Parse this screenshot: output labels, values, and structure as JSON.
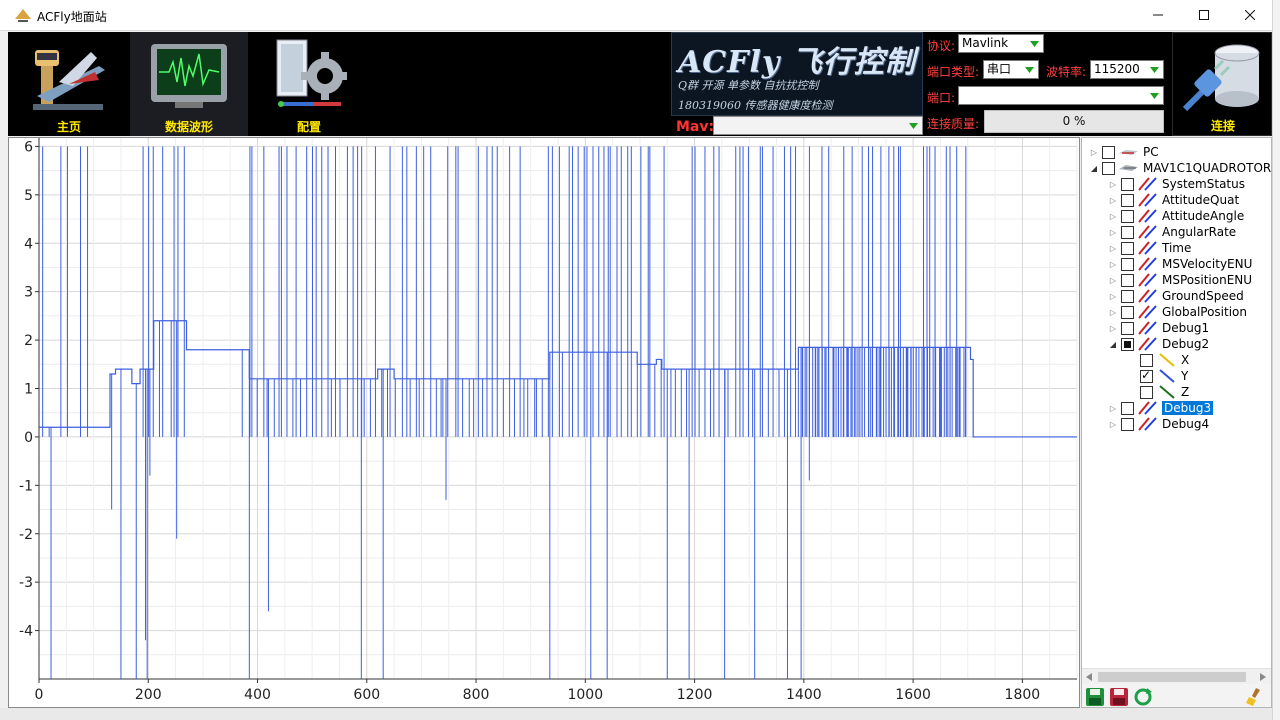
{
  "window": {
    "title": "ACFly地面站"
  },
  "nav": [
    {
      "label": "主页",
      "icon": "airport-tower-icon"
    },
    {
      "label": "数据波形",
      "icon": "oscilloscope-icon"
    },
    {
      "label": "配置",
      "icon": "gear-config-icon"
    }
  ],
  "logo": {
    "title": "ACFly 飞行控制",
    "line1": "Q群   开源 单参数 自抗扰控制",
    "line2": "180319060  传感器健康度检测"
  },
  "mav": {
    "label": "Mav:",
    "value": ""
  },
  "settings": {
    "protocol_label": "协议:",
    "protocol_value": "Mavlink",
    "port_type_label": "端口类型:",
    "port_type_value": "串口",
    "baud_label": "波特率:",
    "baud_value": "115200",
    "port_label": "端口:",
    "port_value": "",
    "quality_label": "连接质量:",
    "quality_value": "0  %"
  },
  "connect": {
    "label": "连接",
    "icon": "database-plug-icon"
  },
  "tree": [
    {
      "label": "PC",
      "level": 0,
      "expand": "collapsed",
      "check": "none",
      "icon": "pc-icon"
    },
    {
      "label": "MAV1C1QUADROTOR",
      "level": 0,
      "expand": "expanded",
      "check": "none",
      "icon": "drone-icon"
    },
    {
      "label": "SystemStatus",
      "level": 1,
      "expand": "collapsed",
      "check": "none",
      "icon": "series-icon"
    },
    {
      "label": "AttitudeQuat",
      "level": 1,
      "expand": "collapsed",
      "check": "none",
      "icon": "series-icon"
    },
    {
      "label": "AttitudeAngle",
      "level": 1,
      "expand": "collapsed",
      "check": "none",
      "icon": "series-icon"
    },
    {
      "label": "AngularRate",
      "level": 1,
      "expand": "collapsed",
      "check": "none",
      "icon": "series-icon"
    },
    {
      "label": "Time",
      "level": 1,
      "expand": "collapsed",
      "check": "none",
      "icon": "series-icon"
    },
    {
      "label": "MSVelocityENU",
      "level": 1,
      "expand": "collapsed",
      "check": "none",
      "icon": "series-icon"
    },
    {
      "label": "MSPositionENU",
      "level": 1,
      "expand": "collapsed",
      "check": "none",
      "icon": "series-icon"
    },
    {
      "label": "GroundSpeed",
      "level": 1,
      "expand": "collapsed",
      "check": "none",
      "icon": "series-icon"
    },
    {
      "label": "GlobalPosition",
      "level": 1,
      "expand": "collapsed",
      "check": "none",
      "icon": "series-icon"
    },
    {
      "label": "Debug1",
      "level": 1,
      "expand": "collapsed",
      "check": "none",
      "icon": "series-icon"
    },
    {
      "label": "Debug2",
      "level": 1,
      "expand": "expanded",
      "check": "partial",
      "icon": "series-icon"
    },
    {
      "label": "X",
      "level": 2,
      "expand": "leaf",
      "check": "none",
      "icon": "line-yellow-icon"
    },
    {
      "label": "Y",
      "level": 2,
      "expand": "leaf",
      "check": "checked",
      "icon": "line-blue-icon"
    },
    {
      "label": "Z",
      "level": 2,
      "expand": "leaf",
      "check": "none",
      "icon": "line-green-icon"
    },
    {
      "label": "Debug3",
      "level": 1,
      "expand": "collapsed",
      "check": "none",
      "icon": "series-icon",
      "selected": true
    },
    {
      "label": "Debug4",
      "level": 1,
      "expand": "collapsed",
      "check": "none",
      "icon": "series-icon"
    }
  ],
  "tools": [
    {
      "icon": "save-green-icon"
    },
    {
      "icon": "save-red-icon"
    },
    {
      "icon": "refresh-icon"
    },
    {
      "icon": "clear-brush-icon"
    }
  ],
  "chart_data": {
    "type": "line",
    "xlim": [
      0,
      1900
    ],
    "ylim": [
      -5,
      6
    ],
    "x_ticks": [
      0,
      200,
      400,
      600,
      800,
      1000,
      1200,
      1400,
      1600,
      1800
    ],
    "y_ticks": [
      6,
      5,
      4,
      3,
      2,
      1,
      0,
      -1,
      -2,
      -3,
      -4
    ],
    "grid": true,
    "series": [
      {
        "color": "#3d5fe0",
        "baseline": [
          [
            0,
            0.2
          ],
          [
            120,
            0.2
          ],
          [
            130,
            1.3
          ],
          [
            140,
            1.4
          ],
          [
            170,
            1.1
          ],
          [
            185,
            1.4
          ],
          [
            210,
            2.4
          ],
          [
            245,
            2.4
          ],
          [
            270,
            1.8
          ],
          [
            380,
            1.8
          ],
          [
            385,
            1.2
          ],
          [
            580,
            1.2
          ],
          [
            620,
            1.4
          ],
          [
            650,
            1.2
          ],
          [
            930,
            1.2
          ],
          [
            935,
            1.75
          ],
          [
            1085,
            1.75
          ],
          [
            1095,
            1.5
          ],
          [
            1130,
            1.6
          ],
          [
            1140,
            1.4
          ],
          [
            1380,
            1.4
          ],
          [
            1390,
            1.85
          ],
          [
            1700,
            1.85
          ],
          [
            1705,
            1.6
          ],
          [
            1710,
            0
          ],
          [
            1900,
            0
          ]
        ],
        "spike_bands": [
          {
            "from": 0,
            "to": 110,
            "step": 17,
            "to_high": 6,
            "to_low": 0
          },
          {
            "from": 190,
            "to": 270,
            "step": 9,
            "to_high": 6,
            "to_low": 0
          },
          {
            "from": 370,
            "to": 1700,
            "step": 9,
            "to_high": 6,
            "to_low": 0
          },
          {
            "from": 1395,
            "to": 1700,
            "step": 5,
            "to_high": 1.85,
            "to_low": 0
          }
        ],
        "negative_spikes": [
          [
            22,
            -5
          ],
          [
            133,
            -1.5
          ],
          [
            150,
            -5
          ],
          [
            178,
            -5
          ],
          [
            195,
            -4.2
          ],
          [
            198,
            -5
          ],
          [
            203,
            -0.8
          ],
          [
            252,
            -2.1
          ],
          [
            385,
            -5
          ],
          [
            420,
            -3.6
          ],
          [
            590,
            -5
          ],
          [
            630,
            -5
          ],
          [
            745,
            -1.3
          ],
          [
            935,
            -5
          ],
          [
            1010,
            -5
          ],
          [
            1040,
            -5
          ],
          [
            1150,
            -5
          ],
          [
            1190,
            -5
          ],
          [
            1255,
            -5
          ],
          [
            1310,
            -5
          ],
          [
            1370,
            -5
          ],
          [
            1395,
            -5
          ],
          [
            1410,
            -0.9
          ]
        ]
      }
    ]
  }
}
